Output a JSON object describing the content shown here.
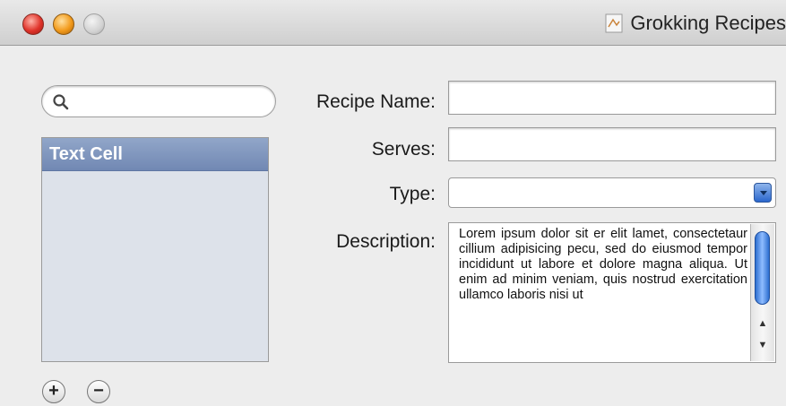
{
  "window": {
    "title": "Grokking Recipes"
  },
  "search": {
    "placeholder": ""
  },
  "list": {
    "items": [
      {
        "label": "Text Cell"
      }
    ]
  },
  "list_buttons": {
    "add": "+",
    "remove": "−"
  },
  "form": {
    "recipe_name": {
      "label": "Recipe Name:",
      "value": ""
    },
    "serves": {
      "label": "Serves:",
      "value": ""
    },
    "type": {
      "label": "Type:",
      "value": ""
    },
    "description": {
      "label": "Description:",
      "text": "Lorem ipsum dolor sit er elit lamet, consectetaur cillium adipisicing pecu, sed do eiusmod tempor incididunt ut labore et dolore magna aliqua. Ut enim ad minim veniam, quis nostrud exercitation ullamco laboris nisi ut"
    }
  },
  "colors": {
    "selection": "#7f97c0",
    "list_bg": "#dde2ea",
    "window_bg": "#ededed"
  }
}
